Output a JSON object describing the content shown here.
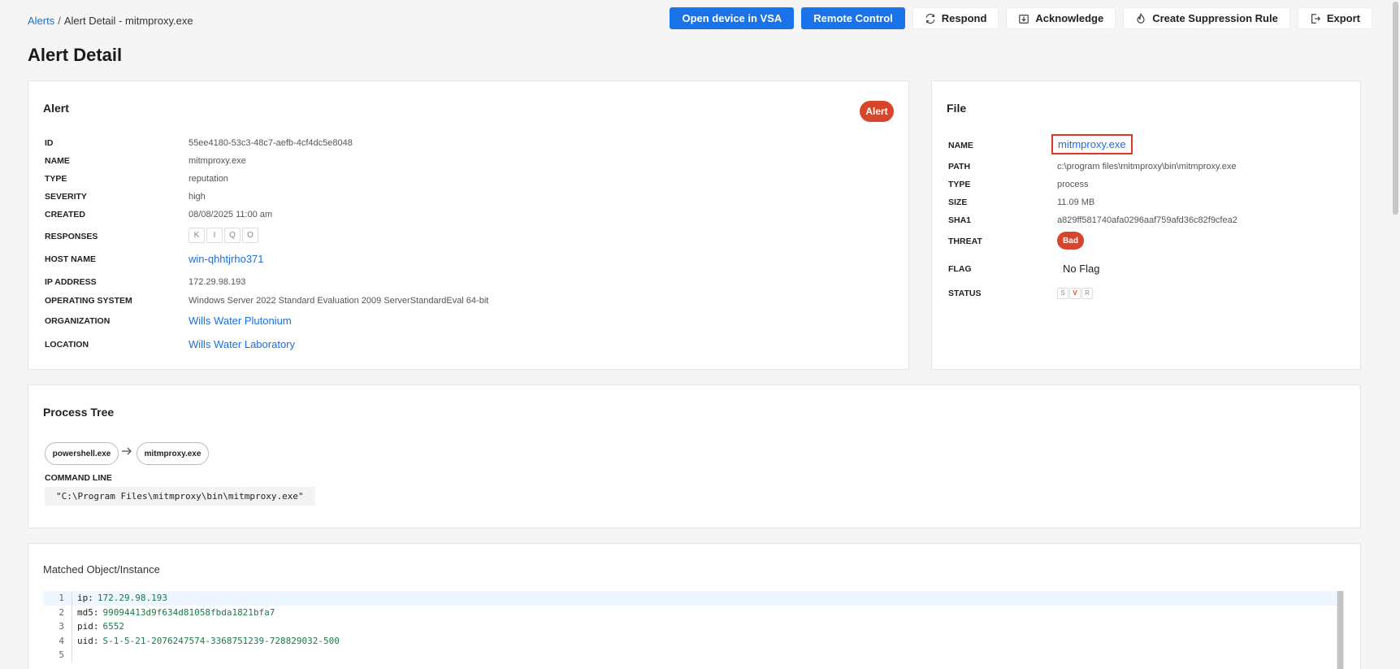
{
  "breadcrumb": {
    "root": "Alerts",
    "separator": "/",
    "current": "Alert Detail - mitmproxy.exe"
  },
  "actions": [
    {
      "label": "Open device in VSA",
      "style": "primary",
      "icon": ""
    },
    {
      "label": "Remote Control",
      "style": "primary",
      "icon": ""
    },
    {
      "label": "Respond",
      "style": "secondary",
      "icon": "refresh-icon"
    },
    {
      "label": "Acknowledge",
      "style": "secondary",
      "icon": "inbox-download-icon"
    },
    {
      "label": "Create Suppression Rule",
      "style": "secondary",
      "icon": "flame-icon"
    },
    {
      "label": "Export",
      "style": "secondary",
      "icon": "export-icon"
    }
  ],
  "page_title": "Alert Detail",
  "alert": {
    "title": "Alert",
    "badge": "Alert",
    "fields": {
      "id": {
        "label": "ID",
        "value": "55ee4180-53c3-48c7-aefb-4cf4dc5e8048"
      },
      "name": {
        "label": "NAME",
        "value": "mitmproxy.exe"
      },
      "type": {
        "label": "TYPE",
        "value": "reputation"
      },
      "severity": {
        "label": "SEVERITY",
        "value": "high"
      },
      "created": {
        "label": "CREATED",
        "value": "08/08/2025 11:00 am"
      },
      "responses": {
        "label": "RESPONSES",
        "items": [
          "K",
          "I",
          "Q",
          "O"
        ]
      },
      "host": {
        "label": "HOST NAME",
        "value": "win-qhhtjrho371"
      },
      "ip": {
        "label": "IP ADDRESS",
        "value": "172.29.98.193"
      },
      "os": {
        "label": "OPERATING SYSTEM",
        "value": "Windows Server 2022 Standard Evaluation 2009 ServerStandardEval 64-bit"
      },
      "org": {
        "label": "ORGANIZATION",
        "value": "Wills Water Plutonium"
      },
      "location": {
        "label": "LOCATION",
        "value": "Wills Water Laboratory"
      }
    }
  },
  "file": {
    "title": "File",
    "fields": {
      "name": {
        "label": "NAME",
        "value": "mitmproxy.exe"
      },
      "path": {
        "label": "PATH",
        "value": "c:\\program files\\mitmproxy\\bin\\mitmproxy.exe"
      },
      "type": {
        "label": "TYPE",
        "value": "process"
      },
      "size": {
        "label": "SIZE",
        "value": "11.09 MB"
      },
      "sha1": {
        "label": "SHA1",
        "value": "a829ff581740afa0296aaf759afd36c82f9cfea2"
      },
      "threat": {
        "label": "THREAT",
        "value": "Bad"
      },
      "flag": {
        "label": "FLAG",
        "value": "No Flag"
      },
      "status": {
        "label": "STATUS",
        "items": [
          "S",
          "V",
          "R"
        ],
        "active": "V"
      }
    }
  },
  "process_tree": {
    "title": "Process Tree",
    "nodes": [
      "powershell.exe",
      "mitmproxy.exe"
    ],
    "command_line_label": "COMMAND LINE",
    "command_line": "\"C:\\Program Files\\mitmproxy\\bin\\mitmproxy.exe\""
  },
  "matched": {
    "title": "Matched Object/Instance",
    "lines": [
      {
        "n": "1",
        "key": "ip:",
        "val": "172.29.98.193"
      },
      {
        "n": "2",
        "key": "md5:",
        "val": "99094413d9f634d81058fbda1821bfa7"
      },
      {
        "n": "3",
        "key": "pid:",
        "val": "6552"
      },
      {
        "n": "4",
        "key": "uid:",
        "val": "S-1-5-21-2076247574-3368751239-728829032-500"
      },
      {
        "n": "5",
        "key": "",
        "val": ""
      }
    ]
  },
  "colors": {
    "primary": "#1a73e8",
    "link": "#1a6fe0",
    "danger": "#d6452c",
    "highlight": "#e0362a"
  }
}
